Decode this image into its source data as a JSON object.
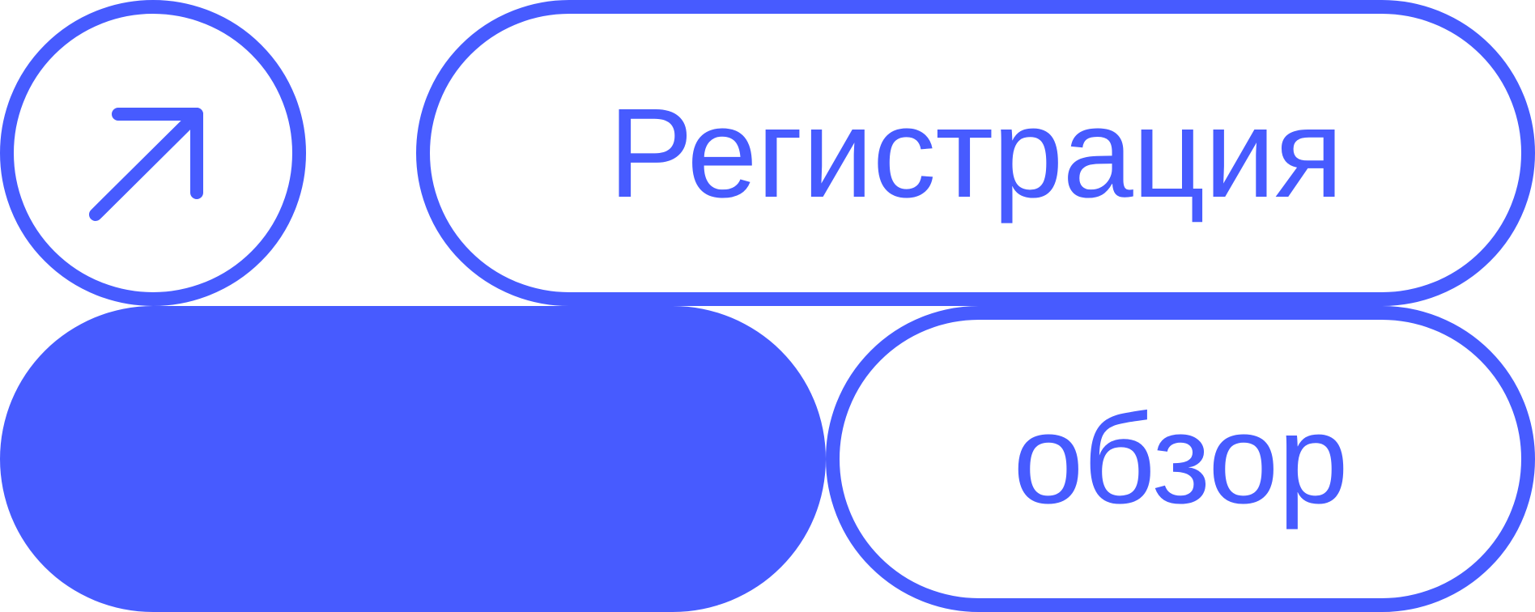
{
  "colors": {
    "accent": "#475BFF",
    "background": "#FFFFFF"
  },
  "buttons": {
    "arrow_button": {
      "icon": "arrow-up-right-icon"
    },
    "register": {
      "label": "Регистрация"
    },
    "blank_filled": {
      "label": ""
    },
    "review": {
      "label": "обзор"
    }
  }
}
